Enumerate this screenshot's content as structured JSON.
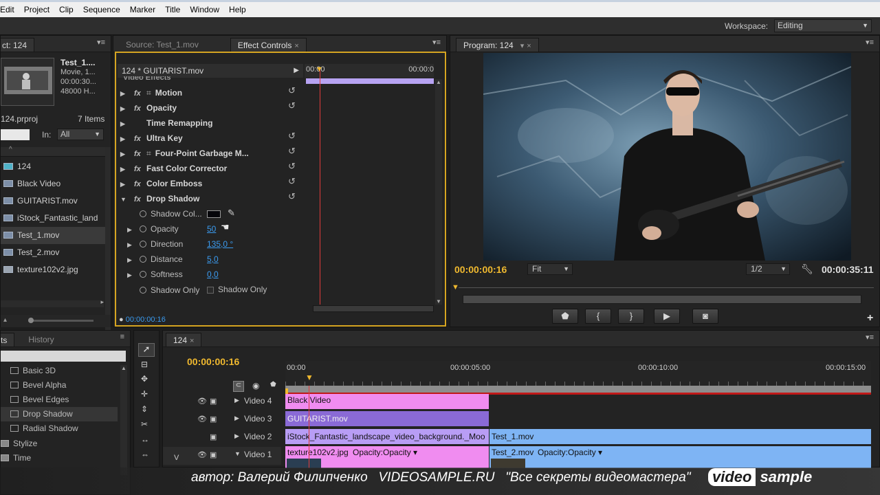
{
  "menu": [
    "Edit",
    "Project",
    "Clip",
    "Sequence",
    "Marker",
    "Title",
    "Window",
    "Help"
  ],
  "workspace": {
    "label": "Workspace:",
    "value": "Editing"
  },
  "project": {
    "tab": "ct: 124",
    "clip_name": "Test_1....",
    "clip_meta": [
      "Movie, 1...",
      "00:00:30...",
      "48000 H..."
    ],
    "project_file": "124.prproj",
    "item_count": "7 Items",
    "in_label": "In:",
    "in_value": "All",
    "items": [
      "124",
      "Black Video",
      "GUITARIST.mov",
      "iStock_Fantastic_land",
      "Test_1.mov",
      "Test_2.mov",
      "texture102v2.jpg"
    ]
  },
  "effect_controls": {
    "tabs": [
      "Source: Test_1.mov",
      "Effect Controls"
    ],
    "clip_title": "124 * GUITARIST.mov",
    "time_start": "00:00",
    "time_end": "00:00:0",
    "section_label": "Video Effects",
    "effects": [
      "Motion",
      "Opacity",
      "Time Remapping",
      "Ultra Key",
      "Four-Point Garbage M...",
      "Fast Color Corrector",
      "Color Emboss",
      "Drop Shadow"
    ],
    "props": [
      {
        "label": "Shadow Col...",
        "value": ""
      },
      {
        "label": "Opacity",
        "value": "50"
      },
      {
        "label": "Direction",
        "value": "135,0 °"
      },
      {
        "label": "Distance",
        "value": "5,0"
      },
      {
        "label": "Softness",
        "value": "0,0"
      },
      {
        "label": "Shadow Only",
        "value": "Shadow Only"
      }
    ],
    "timecode": "00:00:00:16"
  },
  "program": {
    "tab": "Program: 124",
    "timecode_current": "00:00:00:16",
    "fit": "Fit",
    "resolution": "1/2",
    "timecode_total": "00:00:35:11"
  },
  "effects_panel": {
    "tabs": [
      "ts",
      "History"
    ],
    "items": [
      "Basic 3D",
      "Bevel Alpha",
      "Bevel Edges",
      "Drop Shadow",
      "Radial Shadow"
    ],
    "folders": [
      "Stylize",
      "Time"
    ]
  },
  "timeline": {
    "tab": "124",
    "timecode": "00:00:00:16",
    "ruler": [
      "00:00",
      "00:00:05:00",
      "00:00:10:00",
      "00:00:15:00"
    ],
    "tracks": [
      "Video 4",
      "Video 3",
      "Video 2",
      "Video 1"
    ],
    "clips": {
      "black_video": "Black Video",
      "guitarist": "GUITARIST.mov",
      "istock": "iStock_Fantastic_landscape_video_background._Moo",
      "test1": "Test_1.mov",
      "texture": "texture102v2.jpg",
      "texture_fx": "Opacity:Opacity",
      "test2": "Test_2.mov",
      "test2_fx": "Opacity:Opacity"
    }
  },
  "watermark": {
    "text": "автор: Валерий Филипченко   VIDEOSAMPLE.RU   \"Все секреты видеомастера\"",
    "logo_left": "video",
    "logo_right": "sample"
  },
  "colors": {
    "accent_yellow": "#f0b92f",
    "link_blue": "#3b9cf1",
    "clip_pink": "#f08cf0",
    "clip_purple": "#8a6ad6",
    "clip_blue": "#7eb4f4"
  }
}
